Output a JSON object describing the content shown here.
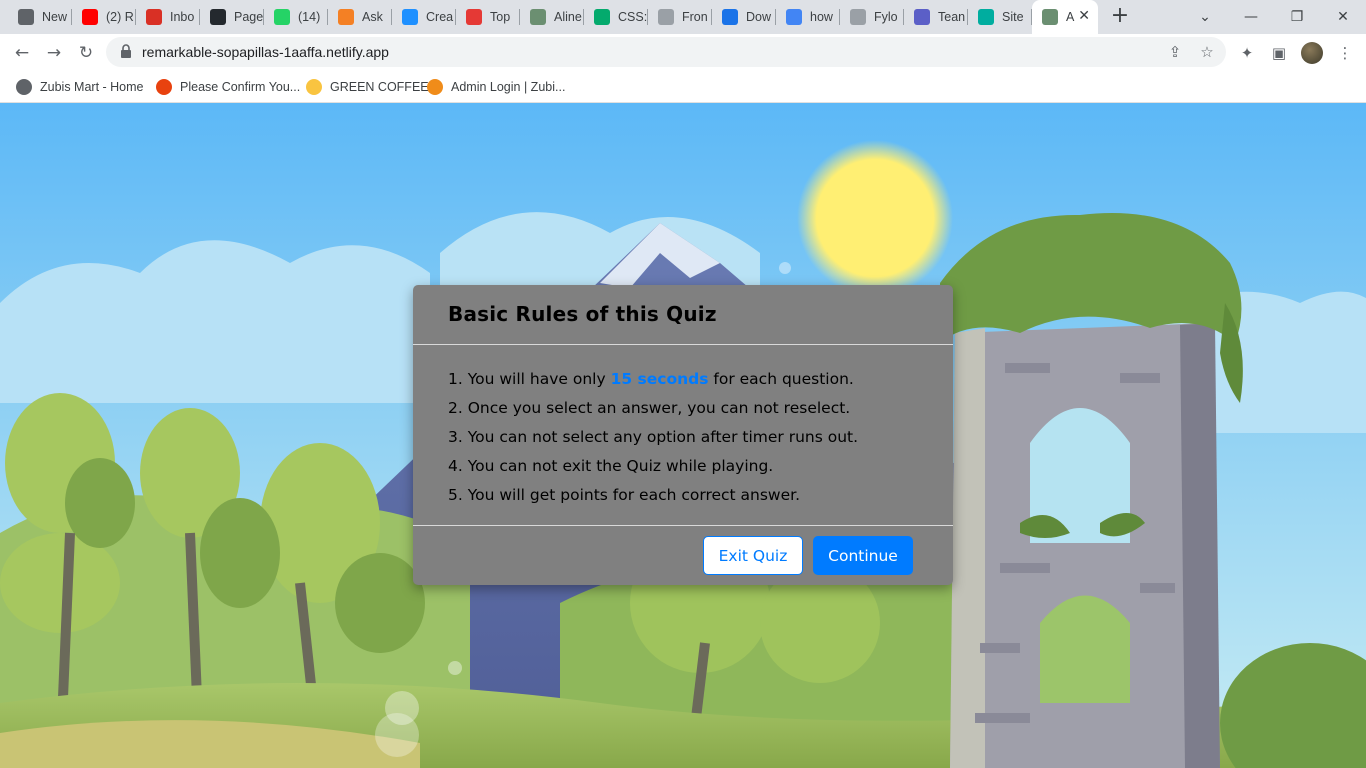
{
  "browser": {
    "tabs": [
      {
        "label": "New",
        "icon": "chrome-icon",
        "color": "#5f6368"
      },
      {
        "label": "(2) R",
        "icon": "youtube-icon",
        "color": "#ff0000"
      },
      {
        "label": "Inbo",
        "icon": "gmail-icon",
        "color": "#d93025"
      },
      {
        "label": "Page",
        "icon": "github-icon",
        "color": "#24292e"
      },
      {
        "label": "(14)",
        "icon": "whatsapp-icon",
        "color": "#25d366"
      },
      {
        "label": "Ask",
        "icon": "stackoverflow-icon",
        "color": "#f48024"
      },
      {
        "label": "Crea",
        "icon": "codenewbie-icon",
        "color": "#1e90ff"
      },
      {
        "label": "Top",
        "icon": "triangle-icon",
        "color": "#e53935"
      },
      {
        "label": "Aline",
        "icon": "image-icon",
        "color": "#6b8f71"
      },
      {
        "label": "CSS:",
        "icon": "w3schools-icon",
        "color": "#04aa6d"
      },
      {
        "label": "Fron",
        "icon": "document-icon",
        "color": "#9aa0a6"
      },
      {
        "label": "Dow",
        "icon": "download-icon",
        "color": "#1a73e8"
      },
      {
        "label": "how",
        "icon": "google-icon",
        "color": "#4285f4"
      },
      {
        "label": "Fylo",
        "icon": "fylo-icon",
        "color": "#9aa0a6"
      },
      {
        "label": "Tean",
        "icon": "teams-icon",
        "color": "#5b5fc7"
      },
      {
        "label": "Site",
        "icon": "netlify-icon",
        "color": "#00ad9f"
      },
      {
        "label": "A",
        "icon": "image-icon",
        "color": "#6b8f71"
      }
    ],
    "url": "remarkable-sopapillas-1aaffa.netlify.app",
    "bookmarks": [
      {
        "label": "Zubis Mart - Home",
        "icon": "globe-icon",
        "color": "#5f6368"
      },
      {
        "label": "Please Confirm You...",
        "icon": "shopping-icon",
        "color": "#e8420f"
      },
      {
        "label": "GREEN COFFEE",
        "icon": "smiley-icon",
        "color": "#f9c440"
      },
      {
        "label": "Admin Login | Zubi...",
        "icon": "zubi-icon",
        "color": "#f08c1a"
      }
    ]
  },
  "quiz": {
    "title": "Basic Rules of this Quiz",
    "rule1_prefix": "1. You will have only ",
    "rule1_highlight": "15 seconds",
    "rule1_suffix": " for each question.",
    "rule2": "2. Once you select an answer, you can not reselect.",
    "rule3": "3. You can not select any option after timer runs out.",
    "rule4": "4. You can not exit the Quiz while playing.",
    "rule5": "5. You will get points for each correct answer.",
    "exit_label": "Exit Quiz",
    "continue_label": "Continue"
  },
  "colors": {
    "accent": "#007bff",
    "modal_bg": "#808080",
    "sky": "#5db8f5"
  }
}
